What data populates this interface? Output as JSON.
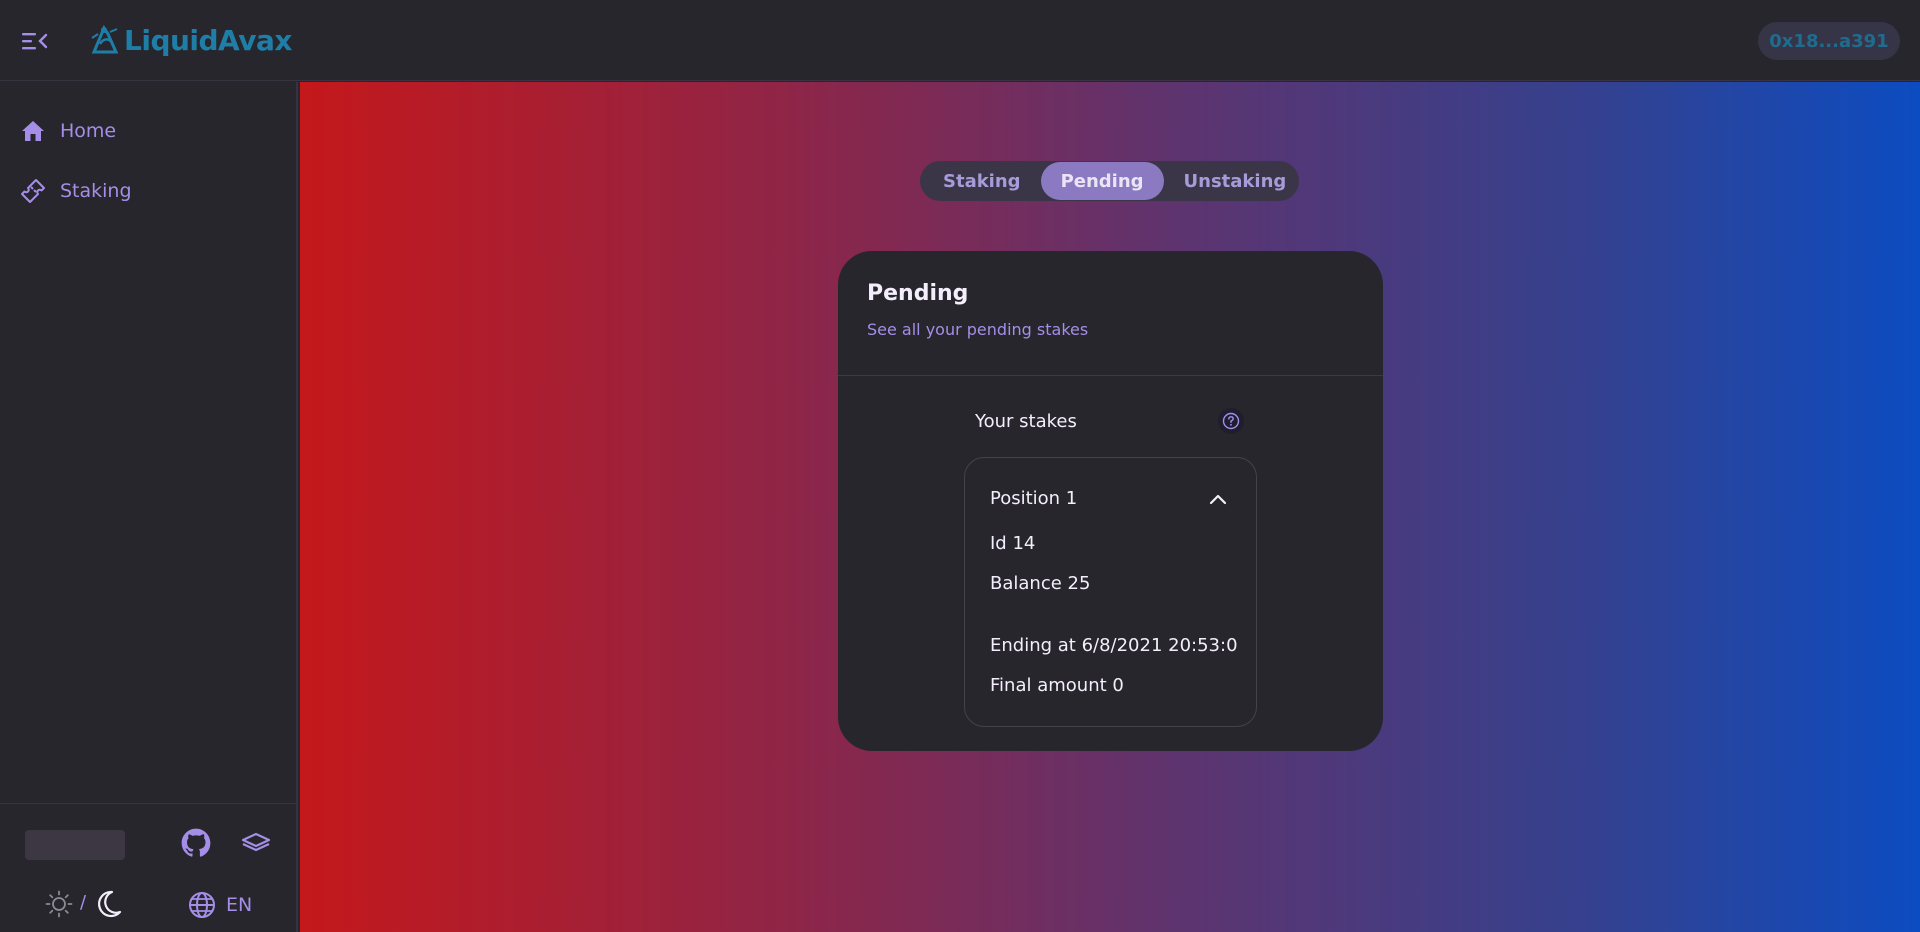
{
  "header": {
    "logo_text": "LiquidAvax",
    "wallet_address": "0x18...a391"
  },
  "sidebar": {
    "items": [
      {
        "label": "Home",
        "icon": "home-icon"
      },
      {
        "label": "Staking",
        "icon": "ticket-icon"
      }
    ],
    "footer": {
      "language": "EN",
      "theme_separator": "/"
    }
  },
  "main": {
    "tabs": [
      {
        "label": "Staking",
        "active": false
      },
      {
        "label": "Pending",
        "active": true
      },
      {
        "label": "Unstaking",
        "active": false
      }
    ],
    "card": {
      "title": "Pending",
      "subtitle": "See all your pending stakes",
      "stakes_label": "Your stakes",
      "position": {
        "title": "Position 1",
        "id_line": "Id 14",
        "balance_line": "Balance 25",
        "ending_line": "Ending at 6/8/2021 20:53:0",
        "final_line": "Final amount 0"
      }
    }
  },
  "colors": {
    "accent": "#a48ee8",
    "brand": "#1f7ea8",
    "background": "#27262c",
    "gradient_left": "#c4181b",
    "gradient_right": "#0c4cc1"
  }
}
